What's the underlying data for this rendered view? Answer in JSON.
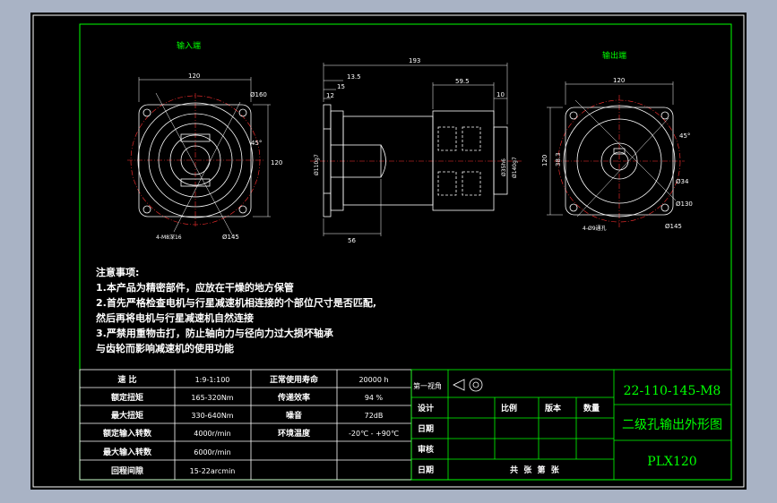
{
  "views": {
    "input_label": "输入端",
    "output_label": "输出端"
  },
  "dims": {
    "input_width": "120",
    "input_d160": "Ø160",
    "input_45": "45°",
    "input_120": "120",
    "input_hole": "4-M8深16",
    "input_d145": "Ø145",
    "side_193": "193",
    "side_13_5": "13.5",
    "side_15": "15",
    "side_12": "12",
    "side_59_5": "59.5",
    "side_10": "10",
    "side_d110": "Ø110g7",
    "side_d35": "Ø35h6",
    "side_d140": "Ø140g7",
    "side_56": "56",
    "out_width": "120",
    "out_45": "45°",
    "out_120": "120",
    "out_38_3": "38.3",
    "out_d34": "Ø34",
    "out_d130": "Ø130",
    "out_hole": "4-Ø9通孔",
    "out_d145": "Ø145"
  },
  "notes": {
    "heading": "注意事项:",
    "items": [
      "1.本产品为精密部件，应放在干燥的地方保管",
      "2.首先严格检查电机与行星减速机相连接的个部位尺寸是否匹配,",
      "然后再将电机与行星减速机自然连接",
      "3.严禁用重物击打，防止轴向力与径向力过大损坏轴承",
      "与齿轮而影响减速机的使用功能"
    ]
  },
  "specs": {
    "rows": [
      [
        "速 比",
        "1:9-1:100",
        "正常使用寿命",
        "20000 h"
      ],
      [
        "额定扭矩",
        "165-320Nm",
        "传递效率",
        "94 %"
      ],
      [
        "最大扭矩",
        "330-640Nm",
        "噪音",
        "72dB"
      ],
      [
        "额定输入转数",
        "4000r/min",
        "环境温度",
        "-20℃ - +90℃"
      ],
      [
        "最大输入转数",
        "6000r/min",
        "",
        ""
      ],
      [
        "回程间隙",
        "15-22arcmin",
        "",
        ""
      ]
    ]
  },
  "title_block": {
    "view_label": "第一视角",
    "design": "设计",
    "date1": "日期",
    "audit": "审核",
    "date2": "日期",
    "scale": "比例",
    "version": "版本",
    "quantity": "数量",
    "sheets": "共  张  第  张",
    "drawing_no": "22-110-145-M8",
    "drawing_title": "二级孔输出外形图",
    "model": "PLX120"
  },
  "colors": {
    "background": "#a9b3c5",
    "sheet": "#000000",
    "frame": "#00ff00",
    "geometry": "#ffffff",
    "centerline": "#ff3030"
  }
}
